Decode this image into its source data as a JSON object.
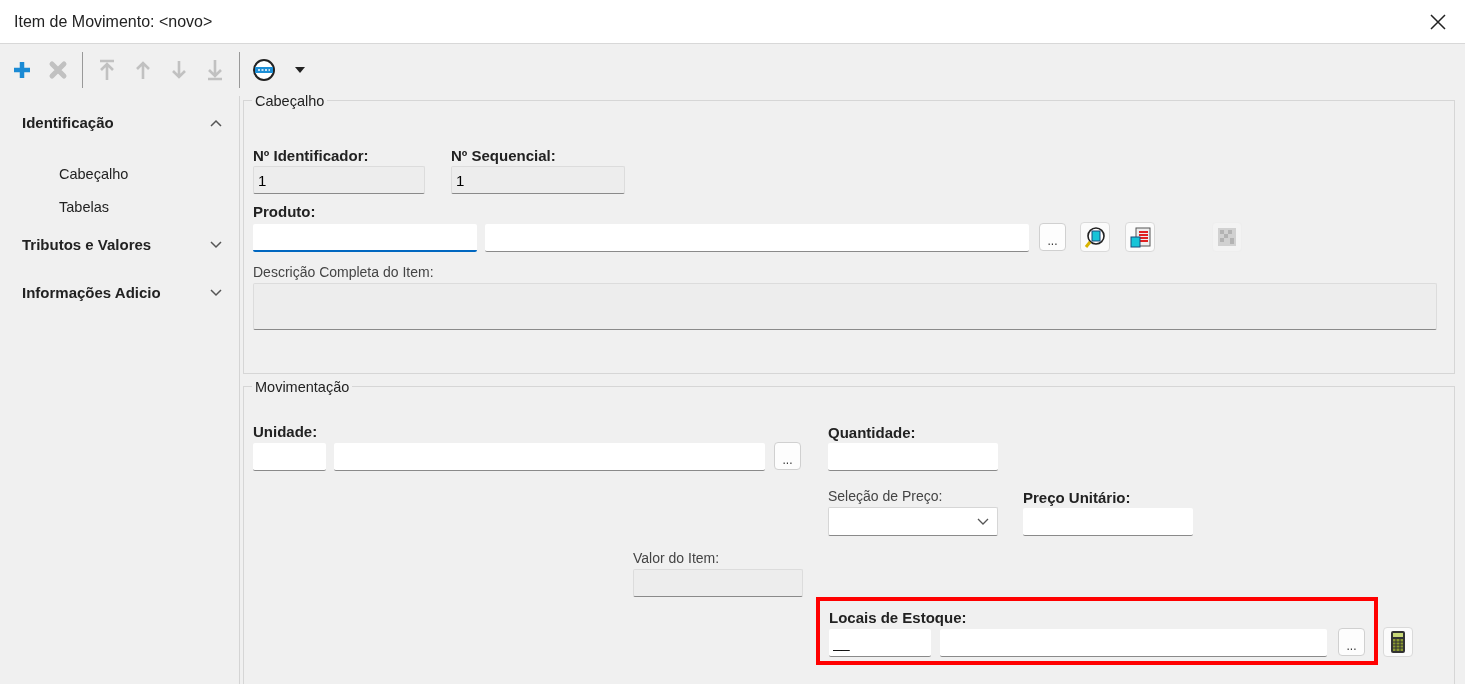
{
  "window": {
    "title": "Item de Movimento: <novo>"
  },
  "toolbar": {
    "groups": [
      {
        "buttons": [
          {
            "kind": "add",
            "disabled": false
          },
          {
            "kind": "delete",
            "disabled": true
          }
        ]
      },
      {
        "buttons": [
          {
            "kind": "move_first",
            "disabled": true
          },
          {
            "kind": "move_up",
            "disabled": true
          },
          {
            "kind": "move_down",
            "disabled": true
          },
          {
            "kind": "move_last",
            "disabled": true
          }
        ]
      },
      {
        "buttons": [
          {
            "kind": "options",
            "disabled": false
          },
          {
            "kind": "dropdown",
            "disabled": false
          }
        ]
      }
    ]
  },
  "sidebar": {
    "sections": [
      {
        "title": "Identificação",
        "expanded": true,
        "items": [
          "Cabeçalho",
          "Tabelas"
        ]
      },
      {
        "title": "Tributos e Valores",
        "expanded": false
      },
      {
        "title": "Informações Adicio",
        "expanded": false
      }
    ]
  },
  "cabecalho": {
    "legend": "Cabeçalho",
    "identificador": {
      "label": "Nº Identificador:",
      "required": true,
      "value": "1",
      "readonly": true
    },
    "sequencial": {
      "label": "Nº Sequencial:",
      "required": true,
      "value": "1",
      "readonly": true
    },
    "produto": {
      "label": "Produto:",
      "required": true,
      "focused": true,
      "browse_button": "...",
      "tools": [
        {
          "kind": "search",
          "disabled": false
        },
        {
          "kind": "list",
          "disabled": false
        },
        {
          "kind": "grid",
          "disabled": true
        }
      ]
    },
    "descricao": {
      "label": "Descrição Completa do Item:",
      "required": false,
      "readonly": true
    }
  },
  "movimentacao": {
    "legend": "Movimentação",
    "unidade": {
      "label": "Unidade:",
      "required": true,
      "browse_button": "..."
    },
    "quantidade": {
      "label": "Quantidade:",
      "required": true
    },
    "selecao_preco": {
      "label": "Seleção de Preço:",
      "required": false
    },
    "preco_unitario": {
      "label": "Preço Unitário:",
      "required": true
    },
    "valor_item": {
      "label": "Valor do Item:",
      "required": false,
      "readonly": true
    },
    "locais_estoque": {
      "label": "Locais de Estoque:",
      "required": true,
      "code": "__",
      "browse_button": "...",
      "highlighted": true
    }
  }
}
